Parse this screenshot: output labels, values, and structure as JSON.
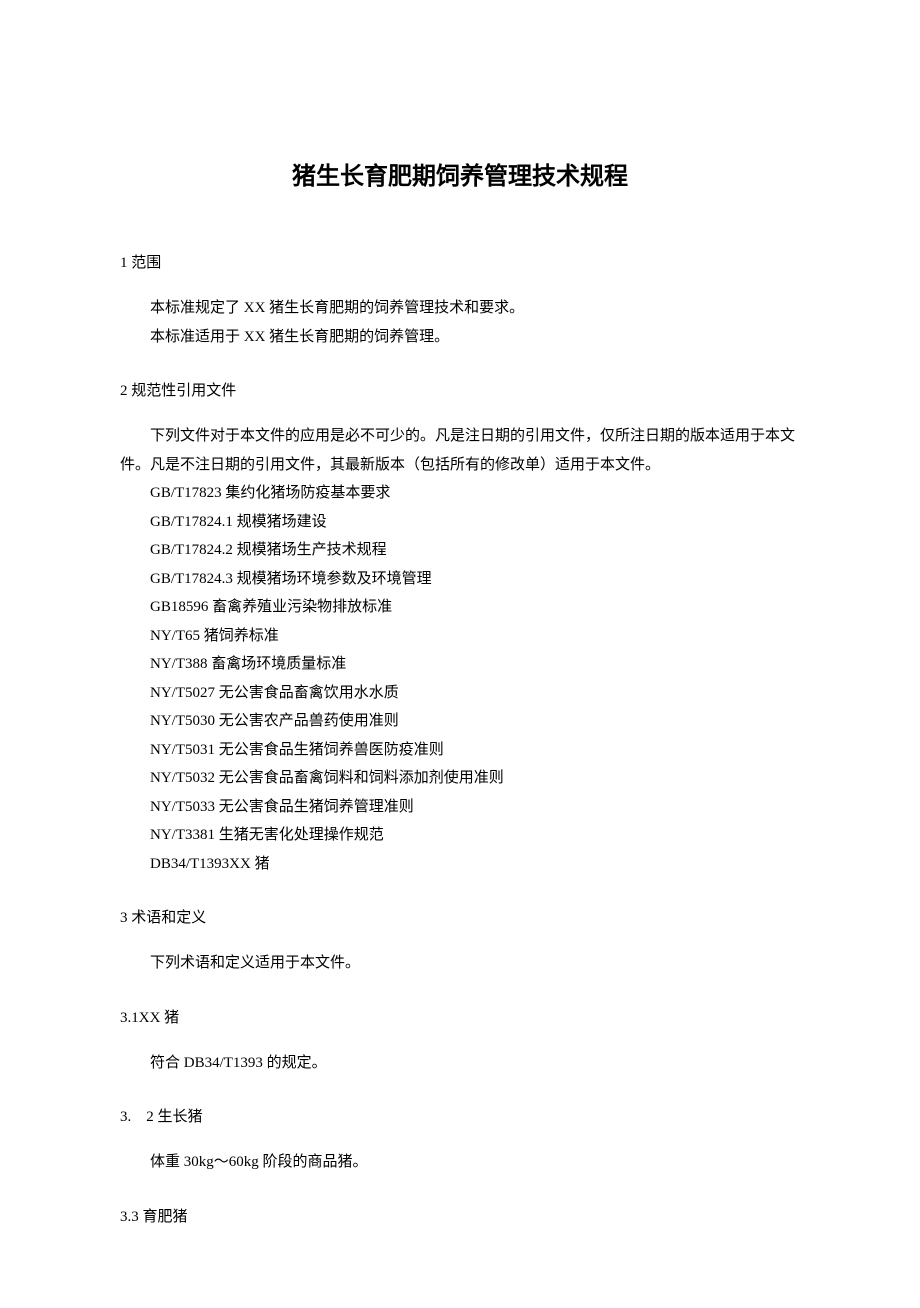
{
  "title": "猪生长育肥期饲养管理技术规程",
  "sections": {
    "s1": {
      "heading": "1 范围",
      "p1": "本标准规定了 XX 猪生长育肥期的饲养管理技术和要求。",
      "p2": "本标准适用于 XX 猪生长育肥期的饲养管理。"
    },
    "s2": {
      "heading": "2 规范性引用文件",
      "intro": "下列文件对于本文件的应用是必不可少的。凡是注日期的引用文件，仅所注日期的版本适用于本文件。凡是不注日期的引用文件，其最新版本（包括所有的修改单）适用于本文件。",
      "refs": [
        "GB/T17823 集约化猪场防疫基本要求",
        "GB/T17824.1 规模猪场建设",
        "GB/T17824.2 规模猪场生产技术规程",
        "GB/T17824.3 规模猪场环境参数及环境管理",
        "GB18596 畜禽养殖业污染物排放标准",
        "NY/T65 猪饲养标准",
        "NY/T388 畜禽场环境质量标准",
        "NY/T5027 无公害食品畜禽饮用水水质",
        "NY/T5030 无公害农产品兽药使用准则",
        "NY/T5031 无公害食品生猪饲养兽医防疫准则",
        "NY/T5032 无公害食品畜禽饲料和饲料添加剂使用准则",
        "NY/T5033 无公害食品生猪饲养管理准则",
        "NY/T3381 生猪无害化处理操作规范",
        "DB34/T1393XX 猪"
      ]
    },
    "s3": {
      "heading": "3 术语和定义",
      "intro": "下列术语和定义适用于本文件。"
    },
    "s3_1": {
      "heading": "3.1XX 猪",
      "body": "符合 DB34/T1393 的规定。"
    },
    "s3_2": {
      "heading": "3.　2 生长猪",
      "body": "体重 30kg～60kg 阶段的商品猪。"
    },
    "s3_3": {
      "heading": "3.3 育肥猪"
    }
  }
}
